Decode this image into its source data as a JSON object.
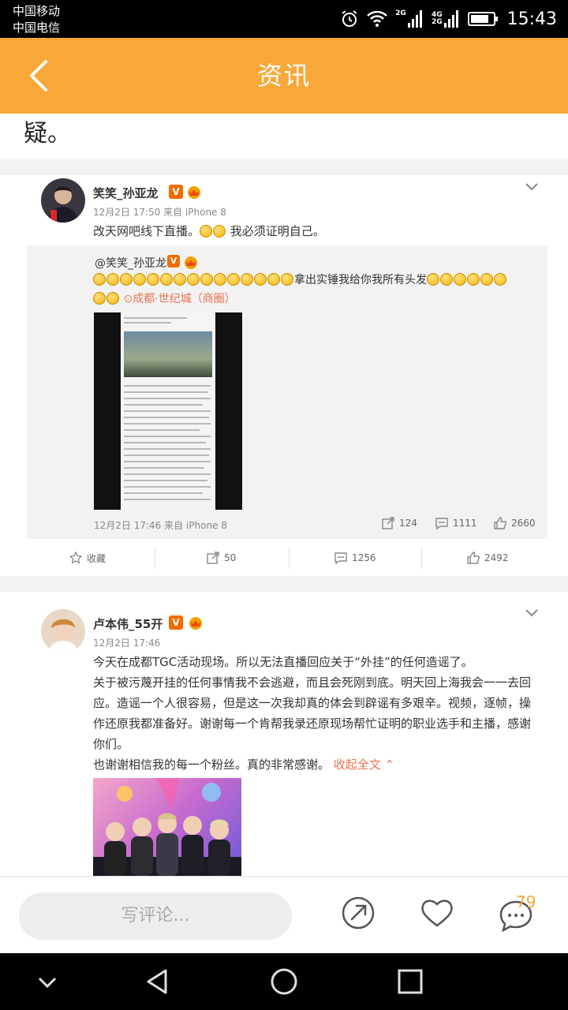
{
  "status_bar": {
    "carrier_1": "中国移动",
    "carrier_2": "中国电信",
    "net_1": "2G",
    "net_2a": "4G",
    "net_2b": "2G",
    "time": "15:43"
  },
  "header": {
    "title": "资讯"
  },
  "content": {
    "tail_text": "疑。"
  },
  "post1": {
    "username": "笑笑_孙亚龙",
    "verified": "V",
    "meta": "12月2日 17:50 来自 iPhone 8",
    "text_before": "改天网吧线下直播。",
    "text_after": " 我必须证明自己。",
    "repost": {
      "username": "@笑笑_孙亚龙",
      "text": "拿出实锤我给你我所有头发",
      "location": "成都·世纪城（商圈）",
      "meta": "12月2日 17:46 来自 iPhone 8",
      "reposts": "124",
      "comments": "1111",
      "likes": "2660"
    },
    "actions": {
      "favorite": "收藏",
      "reposts": "50",
      "comments": "1256",
      "likes": "2492"
    }
  },
  "post2": {
    "username": "卢本伟_55开",
    "verified": "V",
    "meta": "12月2日 17:46",
    "lines": [
      "今天在成都TGC活动现场。所以无法直播回应关于“外挂”的任何造谣了。",
      "关于被污蔑开挂的任何事情我不会逃避，而且会死刚到底。明天回上海我会一一去回应。造谣一个人很容易，但是这一次我却真的体会到辟谣有多艰辛。视频，逐帧，操作还原我都准备好。谢谢每一个肯帮我录还原现场帮忙证明的职业选手和主播，感谢你们。",
      "也谢谢相信我的每一个粉丝。真的非常感谢。"
    ],
    "fold_label": "收起全文 ⌃"
  },
  "bottom_bar": {
    "comment_placeholder": "写评论...",
    "comment_count": "79"
  },
  "colors": {
    "header": "#f8a838",
    "badge": "#f26d00",
    "link": "#eb7350"
  }
}
